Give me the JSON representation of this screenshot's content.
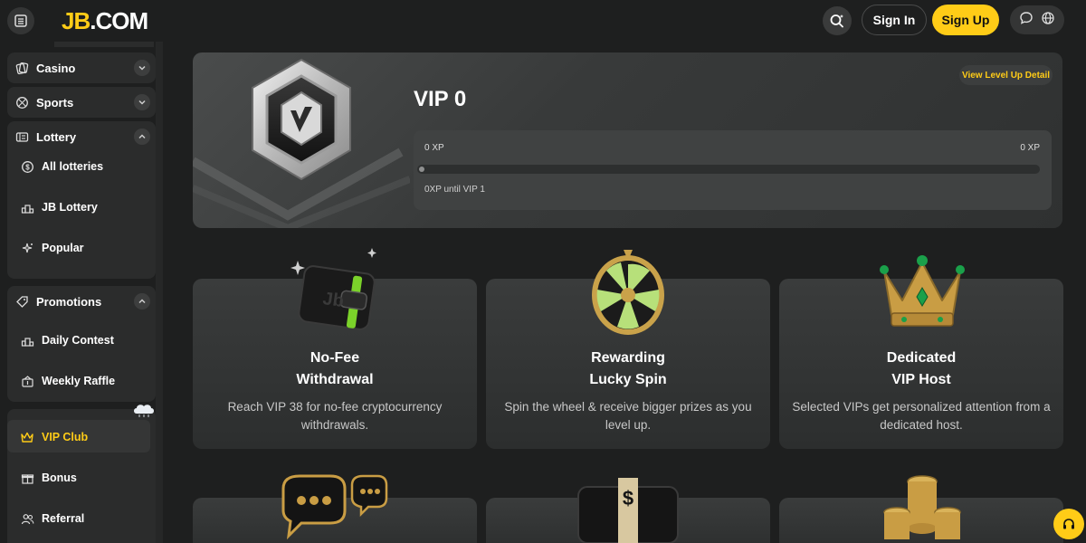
{
  "header": {
    "logo_jb": "JB",
    "logo_com": ".COM",
    "signin_label": "Sign In",
    "signup_label": "Sign Up",
    "icons": [
      "menu-icon",
      "search-icon",
      "chat-icon",
      "globe-icon"
    ]
  },
  "sidebar": {
    "casino": "Casino",
    "sports": "Sports",
    "lottery": "Lottery",
    "lottery_items": [
      "All lotteries",
      "JB Lottery",
      "Popular"
    ],
    "promotions": "Promotions",
    "promotions_items": [
      "Daily Contest",
      "Weekly Raffle"
    ],
    "vip_club": "VIP Club",
    "bonus": "Bonus",
    "referral": "Referral"
  },
  "hero": {
    "vip_title": "VIP 0",
    "levelup_label": "View Level Up Detail",
    "xp_current": "0 XP",
    "xp_target": "0 XP",
    "xp_progress": 0.0,
    "xp_until": "0XP until VIP 1"
  },
  "cards": [
    {
      "title1": "No-Fee",
      "title2": "Withdrawal",
      "desc": "Reach VIP 38 for no-fee cryptocurrency withdrawals."
    },
    {
      "title1": "Rewarding",
      "title2": "Lucky Spin",
      "desc": "Spin the wheel & receive bigger prizes as you level up."
    },
    {
      "title1": "Dedicated",
      "title2": "VIP Host",
      "desc": "Selected VIPs get personalized attention from a dedicated host."
    }
  ],
  "colors": {
    "accent": "#ffcc17",
    "background": "#1e1f1f",
    "panel": "#2b2c2c"
  }
}
